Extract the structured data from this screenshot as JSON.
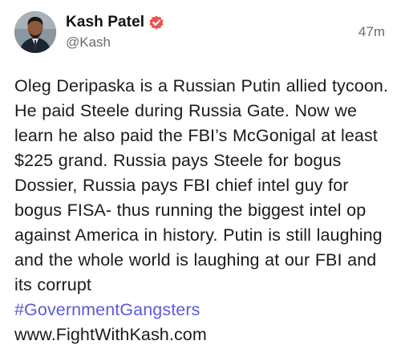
{
  "post": {
    "author": {
      "display_name": "Kash Patel",
      "handle": "@Kash",
      "verified": true,
      "avatar_icon": "profile-photo"
    },
    "timestamp": "47m",
    "body": "Oleg Deripaska is a Russian Putin allied tycoon. He paid Steele during Russia Gate. Now we learn he also paid the FBI’s McGonigal at least $225 grand. Russia pays Steele for bogus Dossier, Russia pays FBI chief intel guy for bogus FISA- thus running the biggest intel op against America in history. Putin is still laughing and the whole world is laughing at our FBI and its corrupt",
    "hashtag": "#GovernmentGangsters",
    "link": "www.FightWithKash.com"
  },
  "colors": {
    "hashtag": "#5b5bd6",
    "verified_badge": "#f0524f",
    "muted_text": "#6b6b6b"
  }
}
